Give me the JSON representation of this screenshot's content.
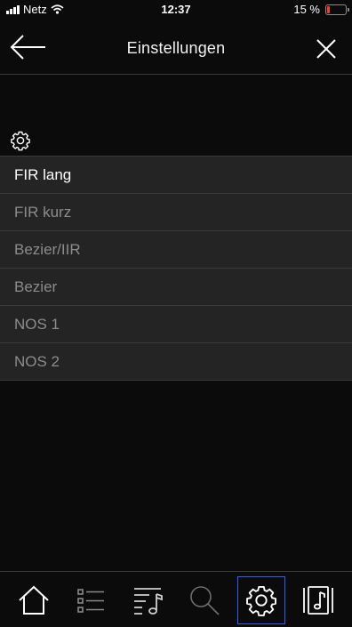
{
  "status_bar": {
    "carrier": "Netz",
    "time": "12:37",
    "battery": "15 %",
    "battery_level": 0.15,
    "battery_color": "#ff3b30"
  },
  "header": {
    "title": "Einstellungen",
    "back_icon": "arrow-left-icon",
    "close_icon": "close-icon"
  },
  "section": {
    "icon": "gear-icon"
  },
  "filters": {
    "selected_index": 0,
    "items": [
      {
        "label": "FIR lang"
      },
      {
        "label": "FIR kurz"
      },
      {
        "label": "Bezier/IIR"
      },
      {
        "label": "Bezier"
      },
      {
        "label": "NOS 1"
      },
      {
        "label": "NOS 2"
      }
    ]
  },
  "tabbar": {
    "active": "settings",
    "accent_color": "#2d5cff",
    "tabs": [
      {
        "id": "home",
        "icon": "home-icon"
      },
      {
        "id": "list",
        "icon": "list-icon"
      },
      {
        "id": "playlist",
        "icon": "playlist-icon"
      },
      {
        "id": "search",
        "icon": "search-icon"
      },
      {
        "id": "settings",
        "icon": "gear-icon"
      },
      {
        "id": "now-playing",
        "icon": "now-playing-icon"
      }
    ]
  }
}
